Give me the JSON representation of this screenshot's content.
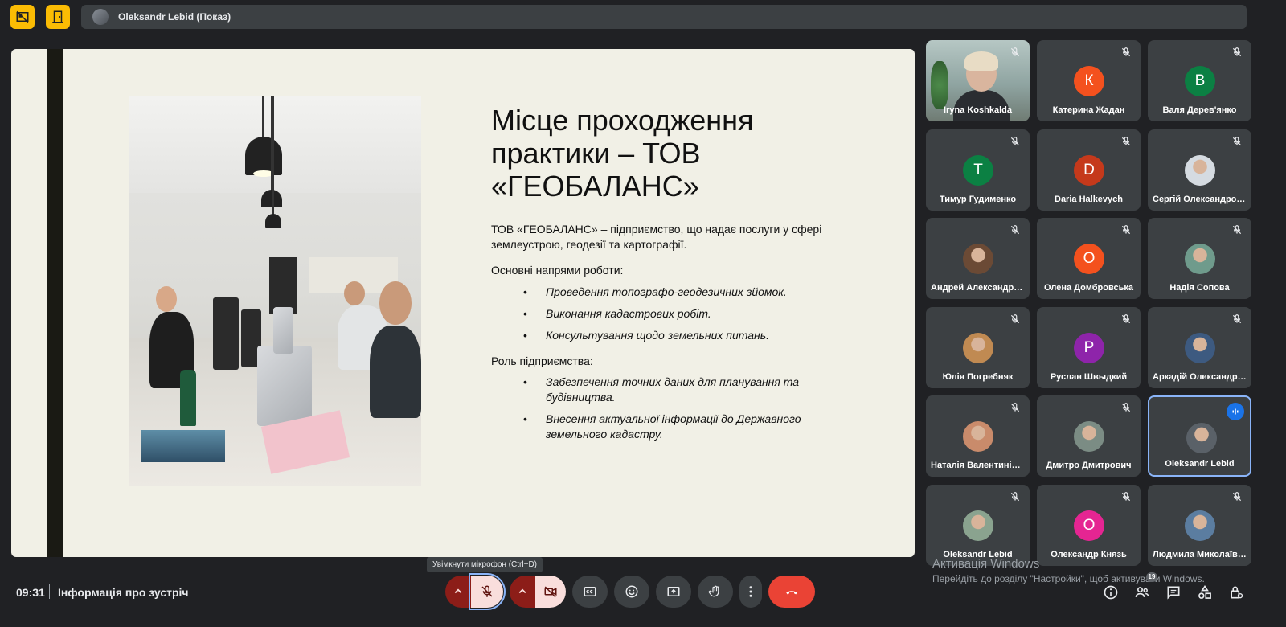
{
  "top": {
    "presenter_name": "Oleksandr Lebid (Показ)"
  },
  "slide": {
    "title": "Місце проходження практики – ТОВ «ГЕОБАЛАНС»",
    "intro": "ТОВ «ГЕОБАЛАНС» – підприємство, що надає послуги у сфері землеустрою, геодезії та картографії.",
    "section1": "Основні напрями роботи:",
    "section1_items": [
      "Проведення топографо-геодезичних зйомок.",
      "Виконання кадастрових робіт.",
      "Консультування щодо земельних питань."
    ],
    "section2": "Роль підприємства:",
    "section2_items": [
      "Забезпечення точних даних для планування та будівництва.",
      "Внесення актуальної інформації до Державного земельного кадастру."
    ]
  },
  "participants": [
    {
      "name": "Iryna Koshkalda",
      "type": "video"
    },
    {
      "name": "Катерина Жадан",
      "initial": "К",
      "color": "#f4511e"
    },
    {
      "name": "Валя Дерев'янко",
      "initial": "В",
      "color": "#0b8043"
    },
    {
      "name": "Тимур Гудименко",
      "initial": "Т",
      "color": "#0b8043"
    },
    {
      "name": "Daria Halkevych",
      "initial": "D",
      "color": "#c5391b"
    },
    {
      "name": "Сергій Олександрович",
      "avatar": "photo",
      "color": "#d5dbe1"
    },
    {
      "name": "Андрей Александрович",
      "avatar": "photo",
      "color": "#6b4a35"
    },
    {
      "name": "Олена Домбровська",
      "initial": "О",
      "color": "#f4511e"
    },
    {
      "name": "Надія Сопова",
      "avatar": "photo",
      "color": "#6f9b8c"
    },
    {
      "name": "Юлія Погребняк",
      "avatar": "photo",
      "color": "#c08a52"
    },
    {
      "name": "Руслан Швыдкий",
      "initial": "Р",
      "color": "#8e24aa"
    },
    {
      "name": "Аркадій Олександрович",
      "avatar": "photo",
      "color": "#3d5a80"
    },
    {
      "name": "Наталія Валентинівна",
      "avatar": "photo",
      "color": "#c98b6b"
    },
    {
      "name": "Дмитро Дмитрович",
      "avatar": "photo",
      "color": "#7b8c84"
    },
    {
      "name": "Oleksandr Lebid",
      "avatar": "photo",
      "color": "#5a6168",
      "active": true
    },
    {
      "name": "Oleksandr Lebid",
      "avatar": "photo",
      "color": "#8aa38f"
    },
    {
      "name": "Олександр Князь",
      "initial": "О",
      "color": "#e52592"
    },
    {
      "name": "Людмила Миколаївна",
      "avatar": "photo",
      "color": "#5b7da0"
    }
  ],
  "bottom": {
    "time": "09:31",
    "meeting_info": "Інформація про зустріч",
    "tooltip": "Увімкнути мікрофон (Ctrl+D)",
    "participants_count": "19",
    "win_activation_title": "Активація Windows",
    "win_activation_text": "Перейдіть до розділу \"Настройки\", щоб активувати Windows."
  },
  "icons": {
    "top_left_1": "hide-tiles-icon",
    "top_left_2": "door-icon",
    "mic": "mic-off-icon",
    "camera": "camera-off-icon",
    "captions": "captions-icon",
    "emoji": "emoji-icon",
    "present": "present-icon",
    "hand": "raise-hand-icon",
    "more": "more-vert-icon",
    "hangup": "hang-up-icon"
  },
  "colors": {
    "accent_yellow": "#fbbc04",
    "hangup_red": "#ea4335",
    "active_border": "#8ab4f8"
  }
}
